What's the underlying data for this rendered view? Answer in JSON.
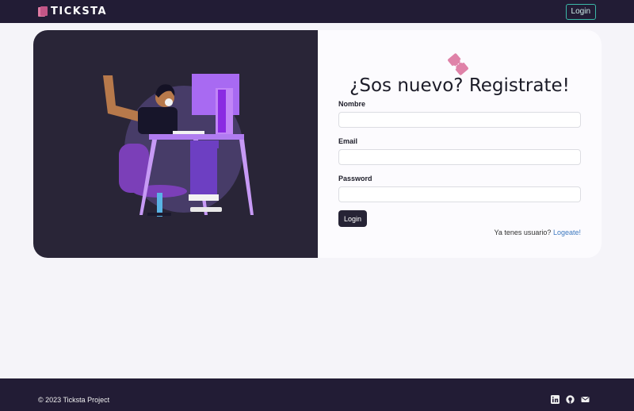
{
  "navbar": {
    "brand": "TICKSTA",
    "login_label": "Login"
  },
  "form": {
    "title": "¿Sos nuevo? Registrate!",
    "fields": [
      {
        "label": "Nombre",
        "value": "",
        "placeholder": ""
      },
      {
        "label": "Email",
        "value": "",
        "placeholder": ""
      },
      {
        "label": "Password",
        "value": "",
        "placeholder": ""
      }
    ],
    "submit_label": "Login",
    "hint_text": "Ya tenes usuario?",
    "hint_link": "Logeate!"
  },
  "footer": {
    "copyright": "© 2023 Ticksta Project",
    "icons": [
      "linkedin-icon",
      "github-icon",
      "mail-icon"
    ]
  },
  "colors": {
    "navbar_bg": "#221c35",
    "accent_pink": "#e07aa3",
    "link": "#3f7ac0",
    "button_bg": "#262335"
  }
}
